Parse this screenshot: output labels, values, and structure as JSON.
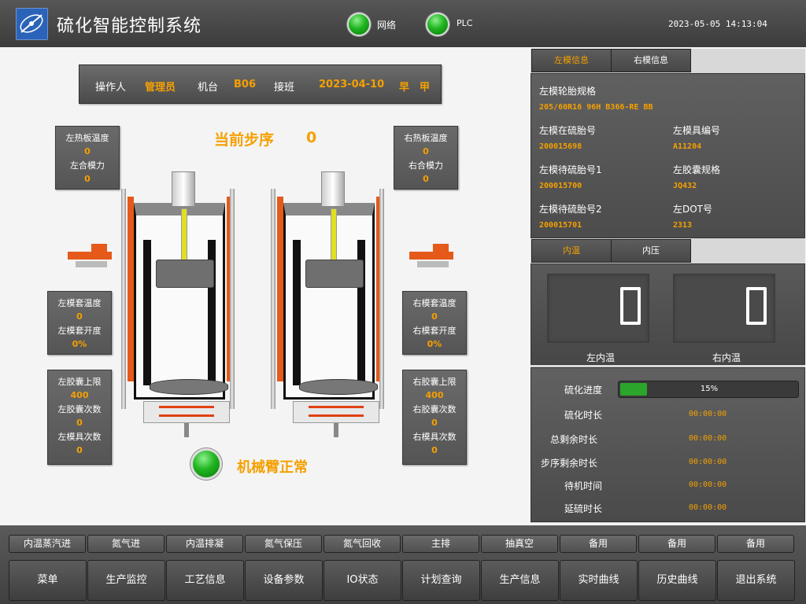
{
  "header": {
    "title": "硫化智能控制系统",
    "logo_icon": "system-logo-icon",
    "status": [
      {
        "label": "网络",
        "state": "green"
      },
      {
        "label": "PLC",
        "state": "green"
      }
    ],
    "datetime": "2023-05-05  14:13:04"
  },
  "operator_bar": {
    "operator_label": "操作人",
    "operator_value": "管理员",
    "machine_label": "机台",
    "machine_value": "B06",
    "shift_label": "接班",
    "shift_date": "2023-04-10",
    "shift_period": "早",
    "shift_team": "甲"
  },
  "step": {
    "label": "当前步序",
    "value": "0"
  },
  "left_boxes": {
    "platen": {
      "k1": "左热板温度",
      "v1": "0",
      "k2": "左合模力",
      "v2": "0"
    },
    "cavity": {
      "k1": "左模套温度",
      "v1": "0",
      "k2": "左模套开度",
      "v2": "0%"
    },
    "bladder": {
      "k1": "左胶囊上限",
      "v1": "400",
      "k2": "左胶囊次数",
      "v2": "0",
      "k3": "左模具次数",
      "v3": "0"
    }
  },
  "right_boxes": {
    "platen": {
      "k1": "右热板温度",
      "v1": "0",
      "k2": "右合模力",
      "v2": "0"
    },
    "cavity": {
      "k1": "右模套温度",
      "v1": "0",
      "k2": "右模套开度",
      "v2": "0%"
    },
    "bladder": {
      "k1": "右胶囊上限",
      "v1": "400",
      "k2": "右胶囊次数",
      "v2": "0",
      "k3": "右模具次数",
      "v3": "0"
    }
  },
  "arm": {
    "status_text": "机械臂正常",
    "state": "green"
  },
  "mold_tabs": [
    "左模信息",
    "右模信息"
  ],
  "mold_info": {
    "spec_label": "左模轮胎规格",
    "spec_value": "205/60R16 96H B366-RE BB",
    "tire_no_label": "左模在硫胎号",
    "tire_no_value": "200015698",
    "mold_no_label": "左模具编号",
    "mold_no_value": "A11204",
    "pending1_label": "左模待硫胎号1",
    "pending1_value": "200015700",
    "bladder_spec_label": "左胶囊规格",
    "bladder_spec_value": "JQ432",
    "pending2_label": "左模待硫胎号2",
    "pending2_value": "200015701",
    "dot_label": "左DOT号",
    "dot_value": "2313"
  },
  "temp_tabs": [
    "内温",
    "内压"
  ],
  "temp_panel": {
    "left_value": "0",
    "left_label": "左内温",
    "right_value": "0",
    "right_label": "右内温"
  },
  "process": {
    "progress_label": "硫化进度",
    "progress_percent": 15,
    "progress_text": "15%",
    "rows": [
      {
        "label": "硫化时长",
        "value": "00:00:00"
      },
      {
        "label": "总剩余时长",
        "value": "00:00:00"
      },
      {
        "label": "步序剩余时长",
        "value": "00:00:00"
      },
      {
        "label": "待机时间",
        "value": "00:00:00"
      },
      {
        "label": "延硫时长",
        "value": "00:00:00"
      }
    ]
  },
  "quick_buttons": [
    "内温蒸汽进",
    "氮气进",
    "内温排凝",
    "氮气保压",
    "氮气回收",
    "主排",
    "抽真空",
    "备用",
    "备用",
    "备用"
  ],
  "menu_buttons": [
    "菜单",
    "生产监控",
    "工艺信息",
    "设备参数",
    "IO状态",
    "计划查询",
    "生产信息",
    "实时曲线",
    "历史曲线",
    "退出系统"
  ],
  "colors": {
    "accent": "#f5a000",
    "status_ok": "#20b520",
    "panel": "#555555"
  }
}
